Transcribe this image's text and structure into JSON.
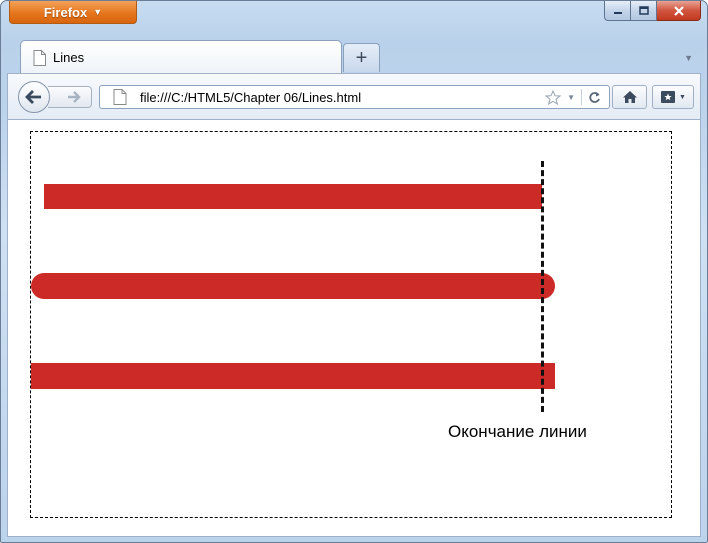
{
  "browser": {
    "app_button_label": "Firefox",
    "tab_title": "Lines",
    "new_tab_label": "+",
    "url": "file:///C:/HTML5/Chapter 06/Lines.html"
  },
  "page": {
    "end_label": "Окончание линии",
    "lines": [
      {
        "cap": "butt",
        "color": "#cc2a27"
      },
      {
        "cap": "round",
        "color": "#cc2a27"
      },
      {
        "cap": "square",
        "color": "#cc2a27"
      }
    ]
  },
  "icons": [
    "caret-down-icon",
    "minimize-icon",
    "maximize-icon",
    "close-icon",
    "page-icon",
    "back-arrow-icon",
    "forward-arrow-icon",
    "star-icon",
    "dropdown-icon",
    "reload-icon",
    "home-icon",
    "bookmarks-icon"
  ]
}
